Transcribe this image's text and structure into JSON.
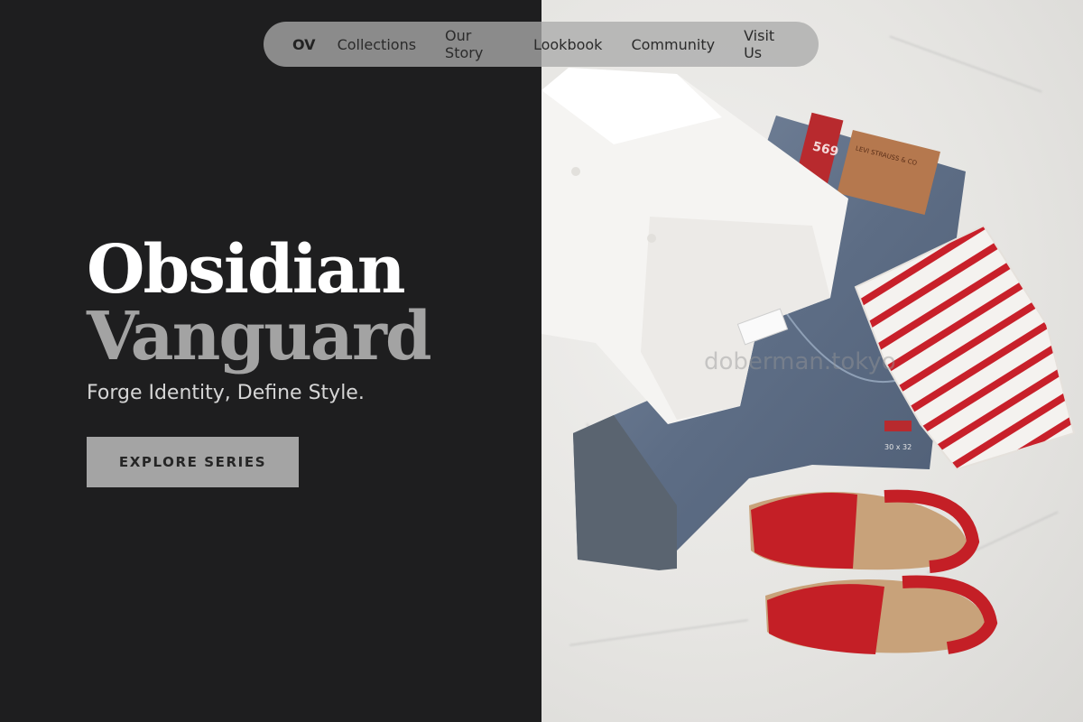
{
  "nav": {
    "brand": "OV",
    "links": [
      "Collections",
      "Our Story",
      "Lookbook",
      "Community",
      "Visit Us"
    ]
  },
  "hero": {
    "title_line1": "Obsidian",
    "title_line2": "Vanguard",
    "subtitle": "Forge Identity, Define Style.",
    "cta_label": "EXPLORE SERIES"
  },
  "image": {
    "jeans_patch": "LEVI STRAUSS & CO",
    "jeans_tag": "569",
    "jeans_size": "30 x 32",
    "watermark": "doberman.tokyo"
  },
  "colors": {
    "background": "#1e1e1f",
    "title_primary": "#ffffff",
    "title_secondary": "#a3a3a3",
    "button_bg": "#a4a4a4",
    "accent_red": "#c8202a"
  }
}
